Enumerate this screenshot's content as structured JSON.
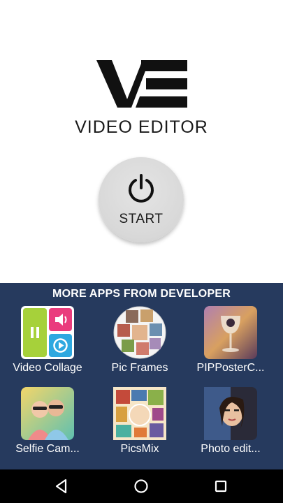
{
  "header": {
    "logo_icon": "ve-logo-icon",
    "app_name": "VIDEO EDITOR"
  },
  "start_button": {
    "icon": "power-icon",
    "label": "START"
  },
  "more_apps": {
    "title": "MORE APPS FROM DEVELOPER",
    "background": "#263a5e",
    "apps": [
      {
        "name": "Video Collage",
        "icon": "video-collage-icon"
      },
      {
        "name": "Pic Frames",
        "icon": "pic-frames-icon"
      },
      {
        "name": "PIPPosterC...",
        "icon": "pip-poster-icon"
      },
      {
        "name": "Selfie Cam...",
        "icon": "selfie-camera-icon"
      },
      {
        "name": "PicsMix",
        "icon": "picsmix-icon"
      },
      {
        "name": "Photo edit...",
        "icon": "photo-editor-icon"
      }
    ]
  },
  "navbar": {
    "back": "back-icon",
    "home": "home-icon",
    "recents": "recents-icon"
  }
}
